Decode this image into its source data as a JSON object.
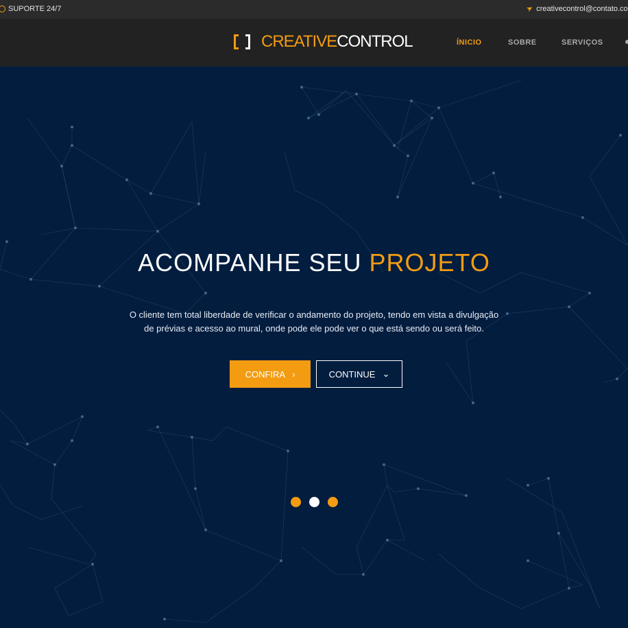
{
  "topbar": {
    "support_label": "SUPORTE 24/7",
    "email": "creativecontrol@contato.co"
  },
  "brand": {
    "word1": "CREATIVE",
    "word2": "CONTROL"
  },
  "nav": {
    "items": [
      {
        "label": "ÍNICIO",
        "active": true
      },
      {
        "label": "SOBRE",
        "active": false
      },
      {
        "label": "SERVIÇOS",
        "active": false
      }
    ]
  },
  "hero": {
    "headline_main": "ACOMPANHE SEU",
    "headline_accent": "PROJETO",
    "description": "O cliente tem total liberdade de verificar o andamento do projeto, tendo em vista a divulgação de prévias e acesso ao mural, onde pode ele pode ver o que está sendo ou será feito.",
    "primary_button": "CONFIRA",
    "secondary_button": "CONTINUE",
    "slides_active_index": 1
  },
  "colors": {
    "accent": "#f39c12",
    "hero_bg": "#031d3f",
    "nav_bg": "#222222",
    "topbar_bg": "#2b2b2b"
  }
}
